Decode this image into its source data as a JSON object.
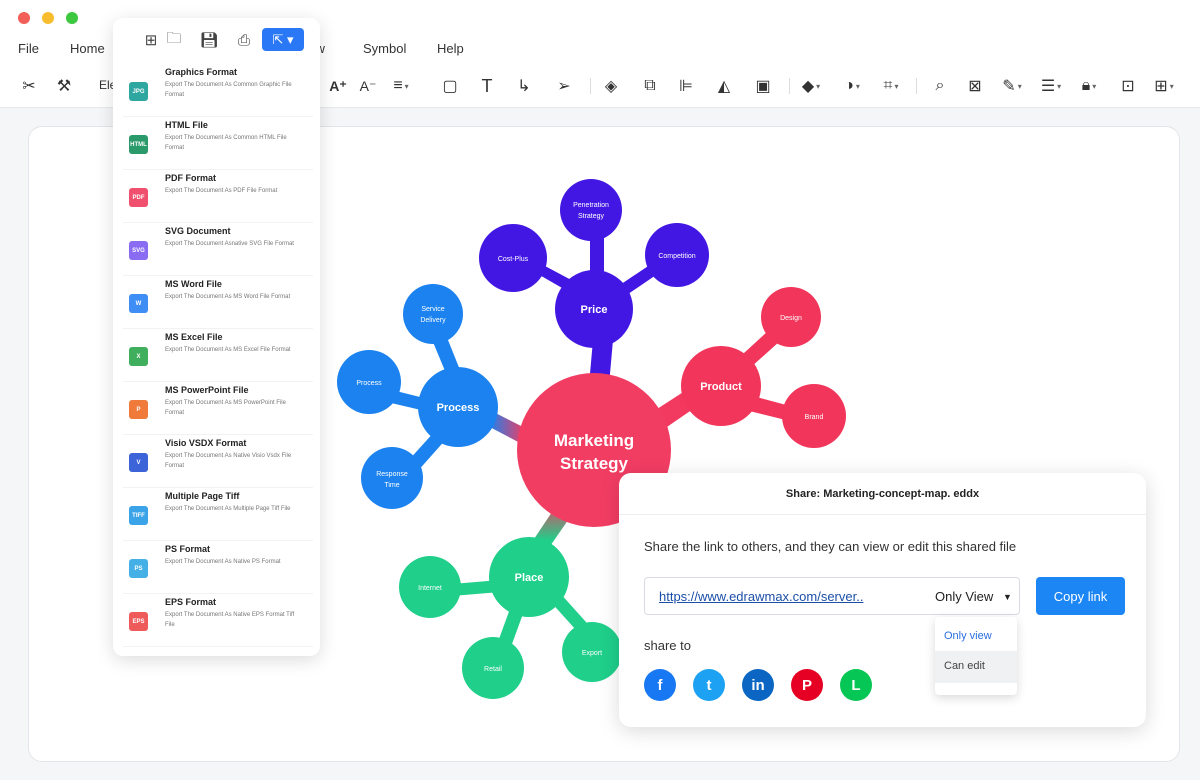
{
  "menu": [
    "File",
    "Home",
    "View",
    "Symbol",
    "Help"
  ],
  "toolbar": {
    "font_name": "Ele"
  },
  "export_panel": {
    "items": [
      {
        "title": "Graphics Format",
        "desc": "Export The Document As Common Graphic File Format",
        "icon": "JPG",
        "color": "#2ea7a0"
      },
      {
        "title": "HTML File",
        "desc": "Export The Document As Common HTML File Format",
        "icon": "HTML",
        "color": "#2b9a6b"
      },
      {
        "title": "PDF Format",
        "desc": "Export The Document As PDF File Format",
        "icon": "PDF",
        "color": "#f0506e"
      },
      {
        "title": "SVG Document",
        "desc": "Export The Document Asnative SVG File Format",
        "icon": "SVG",
        "color": "#8a6cf2"
      },
      {
        "title": "MS Word File",
        "desc": "Export The Document As MS Word File Format",
        "icon": "W",
        "color": "#3f8ef5"
      },
      {
        "title": "MS Excel File",
        "desc": "Export The Document As MS Excel File Format",
        "icon": "X",
        "color": "#3fae5d"
      },
      {
        "title": "MS PowerPoint File",
        "desc": "Export The Document As MS PowerPoint File Format",
        "icon": "P",
        "color": "#f07a3a"
      },
      {
        "title": "Visio VSDX Format",
        "desc": "Export The Document As Native Visio Vsdx File Format",
        "icon": "V",
        "color": "#3d63d9"
      },
      {
        "title": "Multiple Page Tiff",
        "desc": "Export The Document As Multiple Page Tiff File",
        "icon": "TIFF",
        "color": "#3ba3e8"
      },
      {
        "title": "PS Format",
        "desc": "Export The Document As Native PS Format",
        "icon": "PS",
        "color": "#45b0e6"
      },
      {
        "title": "EPS Format",
        "desc": "Export The Document As Native EPS Format Tiff File",
        "icon": "EPS",
        "color": "#ef5b5b"
      }
    ]
  },
  "mindmap": {
    "center": {
      "line1": "Marketing",
      "line2": "Strategy",
      "color": "#f23d63"
    },
    "branches": [
      {
        "label": "Price",
        "color": "#4317e3",
        "children": [
          {
            "line1": "Penetration",
            "line2": "Strategy"
          },
          {
            "line1": "Cost-Plus",
            "line2": ""
          },
          {
            "line1": "Competition",
            "line2": ""
          }
        ]
      },
      {
        "label": "Product",
        "color": "#f2355b",
        "children": [
          {
            "line1": "Design",
            "line2": ""
          },
          {
            "line1": "Brand",
            "line2": ""
          }
        ]
      },
      {
        "label": "Process",
        "color": "#1b82ef",
        "children": [
          {
            "line1": "Service",
            "line2": "Delivery"
          },
          {
            "line1": "Process",
            "line2": ""
          },
          {
            "line1": "Response",
            "line2": "Time"
          }
        ]
      },
      {
        "label": "Place",
        "color": "#1fcf8a",
        "children": [
          {
            "line1": "Internet",
            "line2": ""
          },
          {
            "line1": "Retail",
            "line2": ""
          },
          {
            "line1": "Export",
            "line2": ""
          }
        ]
      }
    ]
  },
  "share": {
    "title": "Share: Marketing-concept-map. eddx",
    "description": "Share the link to others, and they can view or edit this shared file",
    "link": "https://www.edrawmax.com/server..",
    "permission": "Only View",
    "copy_label": "Copy link",
    "share_to": "share to",
    "options": [
      "Only view",
      "Can edit"
    ],
    "socials": [
      {
        "name": "facebook",
        "glyph": "f",
        "color": "#1877f2"
      },
      {
        "name": "twitter",
        "glyph": "t",
        "color": "#1da1f2"
      },
      {
        "name": "linkedin",
        "glyph": "in",
        "color": "#0a66c2"
      },
      {
        "name": "pinterest",
        "glyph": "P",
        "color": "#e60023"
      },
      {
        "name": "line",
        "glyph": "L",
        "color": "#06c755"
      }
    ]
  }
}
